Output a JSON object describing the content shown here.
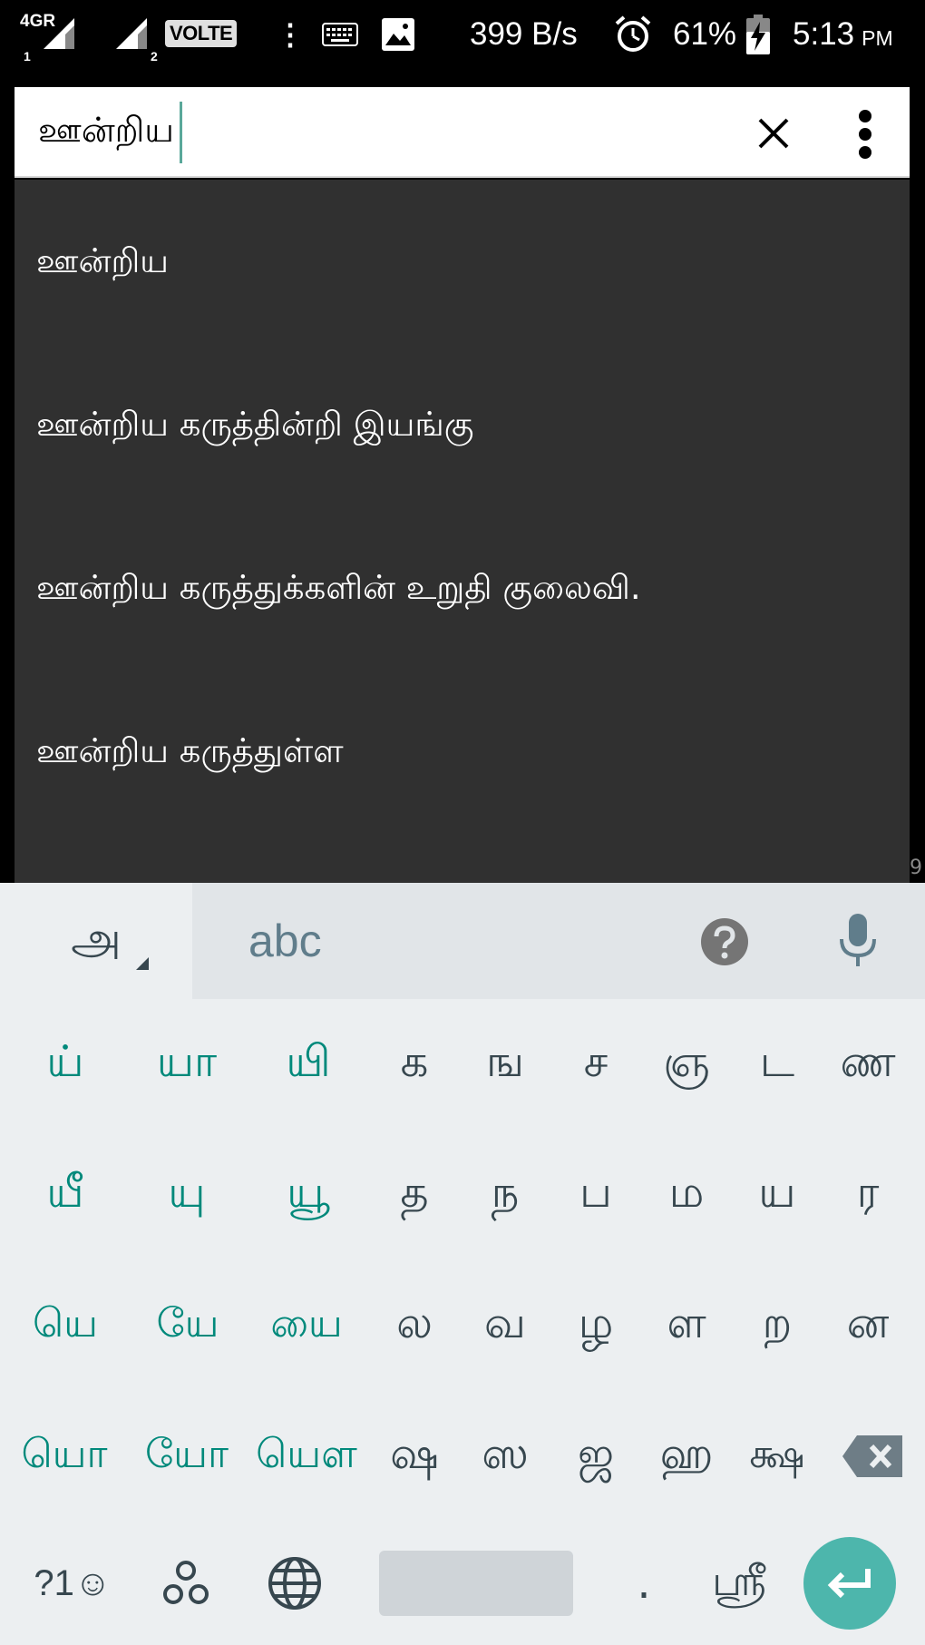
{
  "status_bar": {
    "network": "4GR",
    "sim1": "1",
    "sim2": "2",
    "volte": "VOLTE",
    "net_speed": "399 B/s",
    "battery_percent": "61%",
    "time": "5:13",
    "ampm": "PM",
    "icons": [
      "signal-icon",
      "signal-icon",
      "overflow-dots-icon",
      "keyboard-icon",
      "image-icon",
      "alarm-icon",
      "battery-charging-icon"
    ]
  },
  "search": {
    "query": "ஊன்றிய",
    "clear_icon": "close-icon",
    "menu_icon": "more-vert-icon"
  },
  "suggestions": [
    "ஊன்றிய",
    "ஊன்றிய கருத்தின்றி இயங்கு",
    "ஊன்றிய கருத்துக்களின் உறுதி குலைவி.",
    "ஊன்றிய கருத்துள்ள"
  ],
  "edge_digit": "9",
  "keyboard": {
    "language_key": "அ",
    "strip_label": "abc",
    "help_icon": "help-circle-icon",
    "mic_icon": "mic-icon",
    "rows": [
      [
        "ய்",
        "யா",
        "யி",
        "க",
        "ங",
        "ச",
        "ஞ",
        "ட",
        "ண"
      ],
      [
        "யீ",
        "யு",
        "யூ",
        "த",
        "ந",
        "ப",
        "ம",
        "ய",
        "ர"
      ],
      [
        "யெ",
        "யே",
        "யை",
        "ல",
        "வ",
        "ழ",
        "ள",
        "ற",
        "ன"
      ],
      [
        "யொ",
        "யோ",
        "யௌ",
        "ஷ",
        "ஸ",
        "ஜ",
        "ஹ",
        "க்ஷ"
      ]
    ],
    "teal_keys_per_row": 3,
    "bottom_row": {
      "symbols": "?1☺",
      "emoji_icon": "smiley-icon",
      "dots_icon": "dots-icon",
      "globe_icon": "globe-icon",
      "period": ".",
      "shri": "ஸ்ரீ",
      "enter_icon": "enter-icon",
      "backspace_icon": "backspace-icon"
    }
  },
  "colors": {
    "teal_key": "#00897b",
    "dark_key": "#37474f",
    "enter_bg": "#4db6ac",
    "suggestion_bg": "#303030",
    "keyboard_bg": "#eceff1"
  }
}
